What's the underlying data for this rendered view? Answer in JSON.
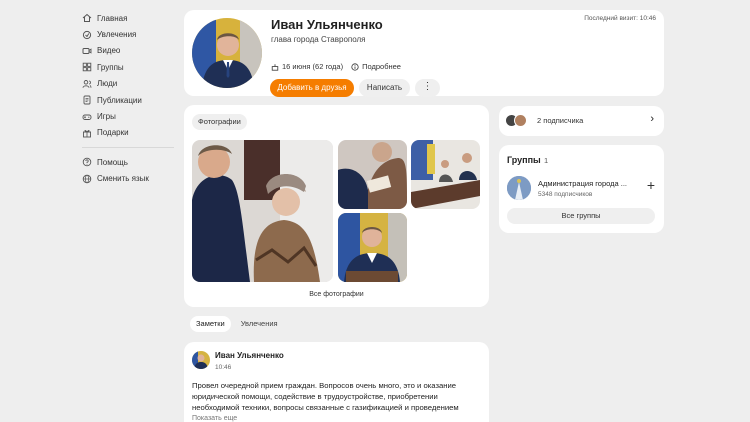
{
  "sidebar": {
    "items": [
      {
        "label": "Главная",
        "icon": "home-icon"
      },
      {
        "label": "Увлечения",
        "icon": "hobbies-icon"
      },
      {
        "label": "Видео",
        "icon": "video-icon"
      },
      {
        "label": "Группы",
        "icon": "groups-icon"
      },
      {
        "label": "Люди",
        "icon": "people-icon"
      },
      {
        "label": "Публикации",
        "icon": "publications-icon"
      },
      {
        "label": "Игры",
        "icon": "games-icon"
      },
      {
        "label": "Подарки",
        "icon": "gifts-icon"
      }
    ],
    "secondary": [
      {
        "label": "Помощь",
        "icon": "help-icon"
      },
      {
        "label": "Сменить язык",
        "icon": "globe-icon"
      }
    ]
  },
  "profile": {
    "name": "Иван Ульянченко",
    "position": "глава города Ставрополя",
    "birthday": "16 июня (62 года)",
    "details_link": "Подробнее",
    "add_friend": "Добавить в друзья",
    "write": "Написать",
    "more": "⋮",
    "last_visit": "Последний визит: 10:46"
  },
  "photos": {
    "tab_label": "Фотографии",
    "all_label": "Все фотографии"
  },
  "subscribers": {
    "label": "2 подписчика",
    "chevron": "›"
  },
  "groups": {
    "title": "Группы",
    "count": "1",
    "item_name": "Администрация города ...",
    "item_subs": "5348 подписчиков",
    "add": "+",
    "all_label": "Все группы"
  },
  "feed_tabs": [
    "Заметки",
    "Увлечения"
  ],
  "post": {
    "author": "Иван Ульянченко",
    "time": "10:46",
    "text": "Провел очередной прием граждан. Вопросов очень много, это и оказание юридической помощи, содействие в трудоустройстве, приобретении необходимой техники, вопросы связанные с газификацией и проведением",
    "more": "Показать еще"
  },
  "colors": {
    "accent": "#f57d00",
    "page_bg": "#eeeeee",
    "card_bg": "#ffffff"
  }
}
